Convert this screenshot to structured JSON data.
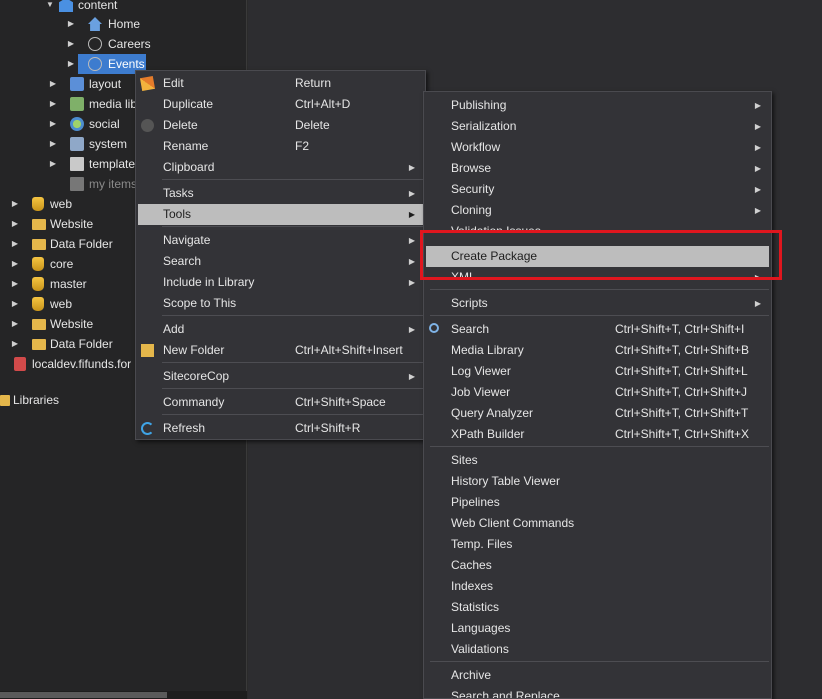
{
  "tree": {
    "nodes": [
      {
        "label": "content",
        "icon": "content-icon",
        "expanded": true
      },
      {
        "label": "Home",
        "icon": "home-icon"
      },
      {
        "label": "Careers",
        "icon": "globe-icon"
      },
      {
        "label": "Events",
        "icon": "globe-icon",
        "selected": true
      },
      {
        "label": "layout",
        "icon": "layout-icon"
      },
      {
        "label": "media lib",
        "icon": "media-icon"
      },
      {
        "label": "social",
        "icon": "social-icon"
      },
      {
        "label": "system",
        "icon": "system-icon"
      },
      {
        "label": "template",
        "icon": "template-icon"
      },
      {
        "label": "my items",
        "icon": "my-items-icon"
      },
      {
        "label": "web",
        "icon": "database-icon"
      },
      {
        "label": "Website",
        "icon": "folder-icon"
      },
      {
        "label": "Data Folder",
        "icon": "folder-icon"
      },
      {
        "label": "core",
        "icon": "database-icon"
      },
      {
        "label": "master",
        "icon": "database-icon"
      },
      {
        "label": "web",
        "icon": "database-icon"
      },
      {
        "label": "Website",
        "icon": "folder-icon"
      },
      {
        "label": "Data Folder",
        "icon": "folder-icon"
      },
      {
        "label": "localdev.fifunds.for",
        "icon": "server-icon"
      },
      {
        "label": "Libraries",
        "icon": "folder-icon"
      }
    ]
  },
  "context_menu": {
    "items": [
      {
        "label": "Edit",
        "shortcut": "Return",
        "icon": "edit-icon"
      },
      {
        "label": "Duplicate",
        "shortcut": "Ctrl+Alt+D"
      },
      {
        "label": "Delete",
        "shortcut": "Delete",
        "icon": "delete-icon"
      },
      {
        "label": "Rename",
        "shortcut": "F2"
      },
      {
        "label": "Clipboard",
        "shortcut": ""
      },
      {
        "label": "Tasks",
        "shortcut": ""
      },
      {
        "label": "Tools",
        "shortcut": ""
      },
      {
        "label": "Navigate",
        "shortcut": ""
      },
      {
        "label": "Search",
        "shortcut": ""
      },
      {
        "label": "Include in Library",
        "shortcut": ""
      },
      {
        "label": "Scope to This",
        "shortcut": ""
      },
      {
        "label": "Add",
        "shortcut": ""
      },
      {
        "label": "New Folder",
        "shortcut": "Ctrl+Alt+Shift+Insert",
        "icon": "new-folder-icon"
      },
      {
        "label": "SitecoreCop",
        "shortcut": ""
      },
      {
        "label": "Commandy",
        "shortcut": "Ctrl+Shift+Space"
      },
      {
        "label": "Refresh",
        "shortcut": "Ctrl+Shift+R",
        "icon": "refresh-icon"
      }
    ]
  },
  "tools_menu": {
    "items": [
      {
        "label": "Publishing",
        "shortcut": ""
      },
      {
        "label": "Serialization",
        "shortcut": ""
      },
      {
        "label": "Workflow",
        "shortcut": ""
      },
      {
        "label": "Browse",
        "shortcut": ""
      },
      {
        "label": "Security",
        "shortcut": ""
      },
      {
        "label": "Cloning",
        "shortcut": ""
      },
      {
        "label": "Validation Issues",
        "shortcut": ""
      },
      {
        "label": "Create Package",
        "shortcut": ""
      },
      {
        "label": "XML",
        "shortcut": ""
      },
      {
        "label": "Scripts",
        "shortcut": ""
      },
      {
        "label": "Search",
        "shortcut": "Ctrl+Shift+T, Ctrl+Shift+I",
        "icon": "search-icon"
      },
      {
        "label": "Media Library",
        "shortcut": "Ctrl+Shift+T, Ctrl+Shift+B"
      },
      {
        "label": "Log Viewer",
        "shortcut": "Ctrl+Shift+T, Ctrl+Shift+L"
      },
      {
        "label": "Job Viewer",
        "shortcut": "Ctrl+Shift+T, Ctrl+Shift+J"
      },
      {
        "label": "Query Analyzer",
        "shortcut": "Ctrl+Shift+T, Ctrl+Shift+T"
      },
      {
        "label": "XPath Builder",
        "shortcut": "Ctrl+Shift+T, Ctrl+Shift+X"
      },
      {
        "label": "Sites",
        "shortcut": ""
      },
      {
        "label": "History Table Viewer",
        "shortcut": ""
      },
      {
        "label": "Pipelines",
        "shortcut": ""
      },
      {
        "label": "Web Client Commands",
        "shortcut": ""
      },
      {
        "label": "Temp. Files",
        "shortcut": ""
      },
      {
        "label": "Caches",
        "shortcut": ""
      },
      {
        "label": "Indexes",
        "shortcut": ""
      },
      {
        "label": "Statistics",
        "shortcut": ""
      },
      {
        "label": "Languages",
        "shortcut": ""
      },
      {
        "label": "Validations",
        "shortcut": ""
      },
      {
        "label": "Archive",
        "shortcut": ""
      },
      {
        "label": "Search and Replace",
        "shortcut": ""
      }
    ]
  },
  "colors": {
    "highlight_box": "#e0161e",
    "selected_node": "#3d7ccf",
    "hover_item": "#bdbdbd"
  }
}
